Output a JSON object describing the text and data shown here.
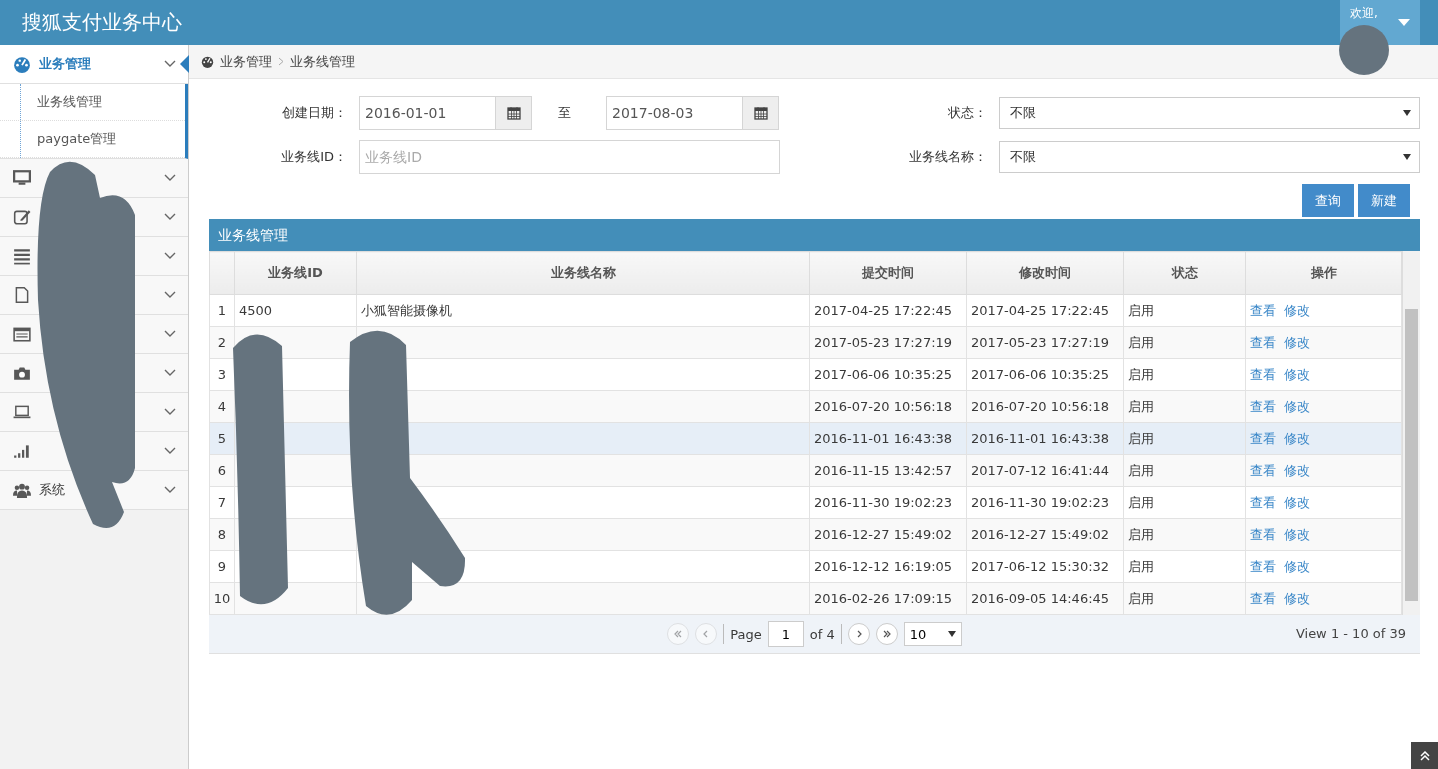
{
  "header": {
    "title": "搜狐支付业务中心",
    "user_menu": {
      "greeting": "欢迎,"
    }
  },
  "sidebar": {
    "items": [
      {
        "kind": "gauge",
        "label": "业务管理",
        "expanded": true,
        "selected": true,
        "children": [
          {
            "label": "业务线管理"
          },
          {
            "label": "paygate管理"
          }
        ]
      },
      {
        "kind": "monitor",
        "expanded": false,
        "selected": false
      },
      {
        "kind": "edit",
        "expanded": false,
        "selected": false
      },
      {
        "kind": "list",
        "expanded": false,
        "selected": false
      },
      {
        "kind": "file",
        "expanded": false,
        "selected": false
      },
      {
        "kind": "card",
        "expanded": false,
        "selected": false
      },
      {
        "kind": "camera",
        "expanded": false,
        "selected": false
      },
      {
        "kind": "laptop",
        "expanded": false,
        "selected": false
      },
      {
        "kind": "signal",
        "expanded": false,
        "selected": false
      },
      {
        "kind": "users",
        "label": "系统",
        "expanded": false,
        "selected": false
      }
    ]
  },
  "breadcrumb": [
    "业务管理",
    "业务线管理"
  ],
  "filters": {
    "date_label": "创建日期：",
    "date_from": "2016-01-01",
    "date_sep": "至",
    "date_to": "2017-08-03",
    "id_label": "业务线ID：",
    "id_placeholder": "业务线ID",
    "status_label": "状态：",
    "status_value": "不限",
    "name_label": "业务线名称：",
    "name_value": "不限"
  },
  "buttons": [
    "查询",
    "新建"
  ],
  "table": {
    "title": "业务线管理",
    "columns": [
      "业务线ID",
      "业务线名称",
      "提交时间",
      "修改时间",
      "状态",
      "操作"
    ],
    "rows": [
      {
        "num": "1",
        "id": "4500",
        "name": "小狐智能摄像机",
        "submitted": "2017-04-25 17:22:45",
        "modified": "2017-04-25 17:22:45",
        "status": "启用",
        "actions": [
          "查看",
          "修改"
        ],
        "selected": false
      },
      {
        "num": "2",
        "submitted": "2017-05-23 17:27:19",
        "modified": "2017-05-23 17:27:19",
        "status": "启用",
        "actions": [
          "查看",
          "修改"
        ],
        "selected": false
      },
      {
        "num": "3",
        "submitted": "2017-06-06 10:35:25",
        "modified": "2017-06-06 10:35:25",
        "status": "启用",
        "actions": [
          "查看",
          "修改"
        ],
        "selected": false
      },
      {
        "num": "4",
        "submitted": "2016-07-20 10:56:18",
        "modified": "2016-07-20 10:56:18",
        "status": "启用",
        "actions": [
          "查看",
          "修改"
        ],
        "selected": false
      },
      {
        "num": "5",
        "submitted": "2016-11-01 16:43:38",
        "modified": "2016-11-01 16:43:38",
        "status": "启用",
        "actions": [
          "查看",
          "修改"
        ],
        "selected": true
      },
      {
        "num": "6",
        "submitted": "2016-11-15 13:42:57",
        "modified": "2017-07-12 16:41:44",
        "status": "启用",
        "actions": [
          "查看",
          "修改"
        ],
        "selected": false
      },
      {
        "num": "7",
        "submitted": "2016-11-30 19:02:23",
        "modified": "2016-11-30 19:02:23",
        "status": "启用",
        "actions": [
          "查看",
          "修改"
        ],
        "selected": false
      },
      {
        "num": "8",
        "submitted": "2016-12-27 15:49:02",
        "modified": "2016-12-27 15:49:02",
        "status": "启用",
        "actions": [
          "查看",
          "修改"
        ],
        "selected": false
      },
      {
        "num": "9",
        "submitted": "2016-12-12 16:19:05",
        "modified": "2017-06-12 15:30:32",
        "status": "启用",
        "actions": [
          "查看",
          "修改"
        ],
        "selected": false
      },
      {
        "num": "10",
        "submitted": "2016-02-26 17:09:15",
        "modified": "2016-09-05 14:46:45",
        "status": "启用",
        "actions": [
          "查看",
          "修改"
        ],
        "selected": false
      }
    ]
  },
  "pager": {
    "page_label": "Page",
    "page": "1",
    "of_label": "of 4",
    "page_size": "10",
    "summary": "View 1 - 10 of 39"
  }
}
